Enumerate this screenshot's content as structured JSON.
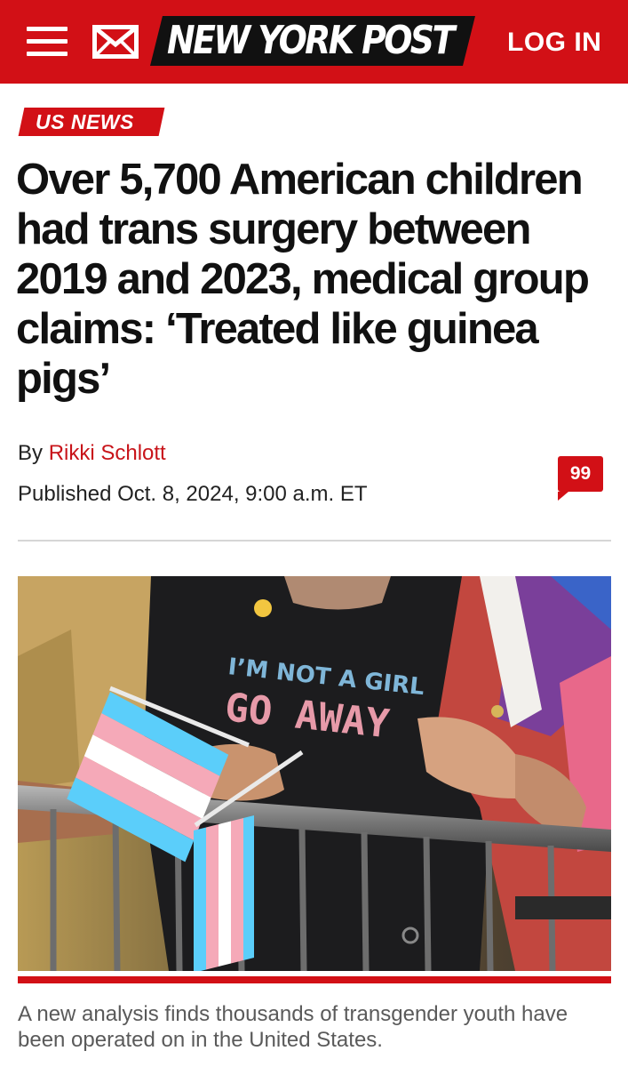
{
  "header": {
    "logo_text": "NEW YORK POST",
    "login_label": "LOG IN",
    "menu_icon": "hamburger-menu-icon",
    "mail_icon": "envelope-icon",
    "brand_color": "#d21016"
  },
  "article": {
    "section": "US NEWS",
    "headline": "Over 5,700 American children had trans surgery between 2019 and 2023, medical group claims: ‘Treated like guinea pigs’",
    "byline_prefix": "By",
    "author": "Rikki Schlott",
    "published": "Published Oct. 8, 2024, 9:00 a.m. ET",
    "comment_count": "99"
  },
  "photo": {
    "shirt_line1": "I’M NOT A GIRL",
    "shirt_line2": "GO AWAY",
    "caption": "A new analysis finds thousands of transgender youth have been operated on in the United States."
  }
}
